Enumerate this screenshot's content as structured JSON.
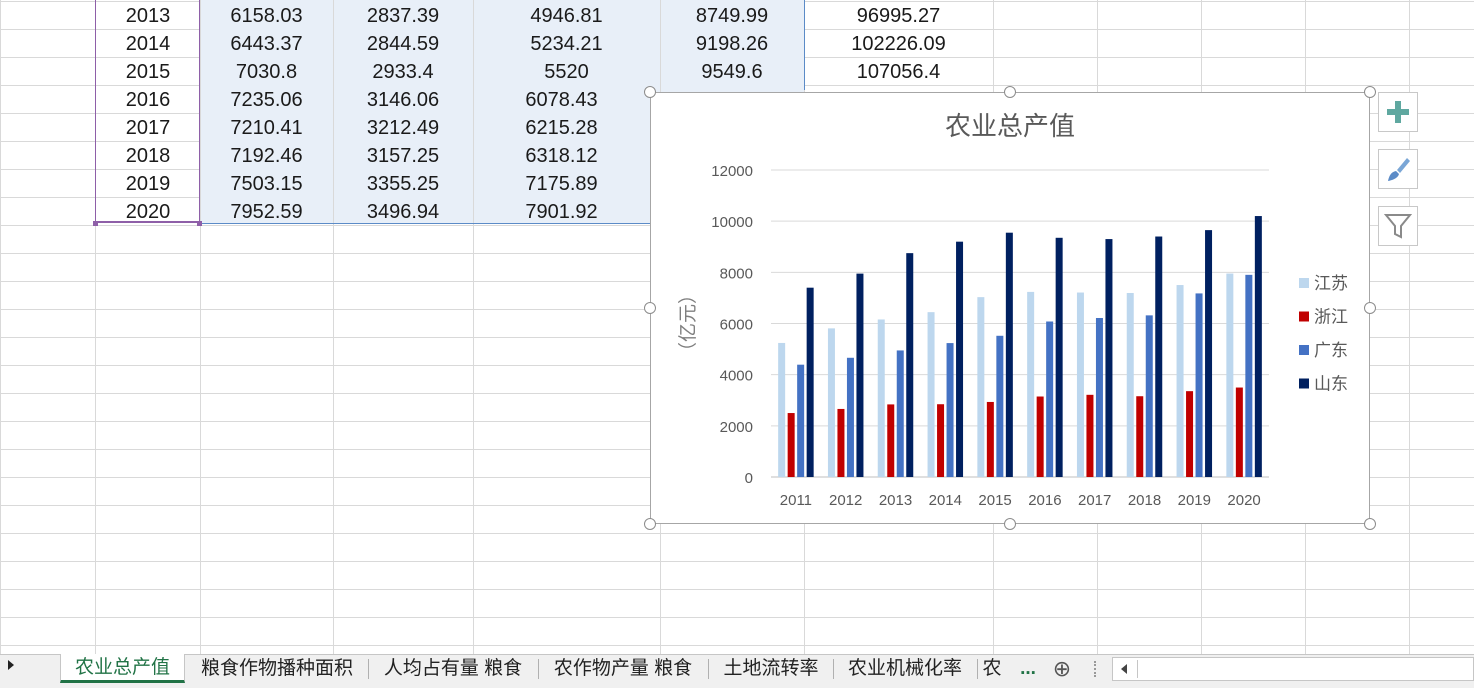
{
  "table": {
    "rows": [
      {
        "year": "2013",
        "c1": "6158.03",
        "c2": "2837.39",
        "c3": "4946.81",
        "c4": "8749.99",
        "c5": "96995.27"
      },
      {
        "year": "2014",
        "c1": "6443.37",
        "c2": "2844.59",
        "c3": "5234.21",
        "c4": "9198.26",
        "c5": "102226.09"
      },
      {
        "year": "2015",
        "c1": "7030.8",
        "c2": "2933.4",
        "c3": "5520",
        "c4": "9549.6",
        "c5": "107056.4"
      },
      {
        "year": "2016",
        "c1": "7235.06",
        "c2": "3146.06",
        "c3": "6078.43",
        "c4": "",
        "c5": ""
      },
      {
        "year": "2017",
        "c1": "7210.41",
        "c2": "3212.49",
        "c3": "6215.28",
        "c4": "",
        "c5": ""
      },
      {
        "year": "2018",
        "c1": "7192.46",
        "c2": "3157.25",
        "c3": "6318.12",
        "c4": "",
        "c5": ""
      },
      {
        "year": "2019",
        "c1": "7503.15",
        "c2": "3355.25",
        "c3": "7175.89",
        "c4": "",
        "c5": ""
      },
      {
        "year": "2020",
        "c1": "7952.59",
        "c2": "3496.94",
        "c3": "7901.92",
        "c4": "",
        "c5": ""
      }
    ]
  },
  "chart_data": {
    "type": "bar",
    "title": "农业总产值",
    "ylabel": "（亿元）",
    "xlabel": "",
    "ylim": [
      0,
      12000
    ],
    "yticks": [
      "0",
      "2000",
      "4000",
      "6000",
      "8000",
      "10000",
      "12000"
    ],
    "grid": true,
    "legend_position": "right",
    "categories": [
      "2011",
      "2012",
      "2013",
      "2014",
      "2015",
      "2016",
      "2017",
      "2018",
      "2019",
      "2020"
    ],
    "series": [
      {
        "name": "江苏",
        "color": "#bdd7ee",
        "values": [
          5240,
          5810,
          6158.03,
          6443.37,
          7030.8,
          7235.06,
          7210.41,
          7192.46,
          7503.15,
          7952.59
        ]
      },
      {
        "name": "浙江",
        "color": "#c00000",
        "values": [
          2500,
          2660,
          2837.39,
          2844.59,
          2933.4,
          3146.06,
          3212.49,
          3157.25,
          3355.25,
          3496.94
        ]
      },
      {
        "name": "广东",
        "color": "#4472c4",
        "values": [
          4390,
          4660,
          4946.81,
          5234.21,
          5520,
          6078.43,
          6215.28,
          6318.12,
          7175.89,
          7901.92
        ]
      },
      {
        "name": "山东",
        "color": "#002060",
        "values": [
          7400,
          7950,
          8749.99,
          9198.26,
          9549.6,
          9350,
          9300,
          9400,
          9650,
          10200
        ]
      }
    ]
  },
  "side_buttons": {
    "add_icon": "plus-icon",
    "style_icon": "brush-icon",
    "filter_icon": "filter-icon"
  },
  "tabs": {
    "items": [
      "农业总产值",
      "粮食作物播种面积",
      "人均占有量 粮食",
      "农作物产量 粮食",
      "土地流转率",
      "农业机械化率",
      "农"
    ],
    "ellipsis": "...",
    "add_symbol": "⊕"
  },
  "colors": {
    "accent": "#217346",
    "selection": "#e8eff8"
  }
}
